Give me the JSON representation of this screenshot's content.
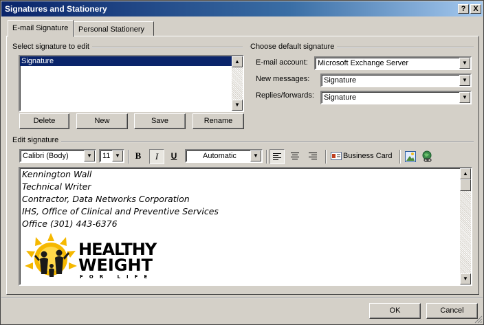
{
  "window": {
    "title": "Signatures and Stationery",
    "help_label": "?",
    "close_label": "X"
  },
  "tabs": [
    {
      "label": "E-mail Signature",
      "active": true
    },
    {
      "label": "Personal Stationery",
      "active": false
    }
  ],
  "select_group": {
    "label": "Select signature to edit",
    "items": [
      "Signature"
    ],
    "selected": "Signature"
  },
  "sig_buttons": {
    "delete": "Delete",
    "new": "New",
    "save": "Save",
    "rename": "Rename"
  },
  "default_group": {
    "label": "Choose default signature",
    "email_account_label": "E-mail account:",
    "email_account_value": "Microsoft Exchange Server",
    "new_messages_label": "New messages:",
    "new_messages_value": "Signature",
    "replies_label": "Replies/forwards:",
    "replies_value": "Signature"
  },
  "edit_group": {
    "label": "Edit signature",
    "font_name": "Calibri (Body)",
    "font_size": "11",
    "bold_label": "B",
    "italic_label": "I",
    "underline_label": "U",
    "color_value": "Automatic",
    "business_card_label": "Business Card"
  },
  "signature_lines": [
    "Kennington Wall",
    "Technical Writer",
    "Contractor, Data Networks Corporation",
    "IHS, Office of Clinical and Preventive Services",
    "Office (301) 443-6376"
  ],
  "logo": {
    "line1": "HEALTHY",
    "line2": "WEIGHT",
    "line3": "FOR LIFE"
  },
  "footer": {
    "ok": "OK",
    "cancel": "Cancel"
  },
  "colors": {
    "titlebar": "#0a246a",
    "selection": "#0a246a",
    "dialog_bg": "#d4d0c8",
    "logo_sun": "#f5b800"
  }
}
